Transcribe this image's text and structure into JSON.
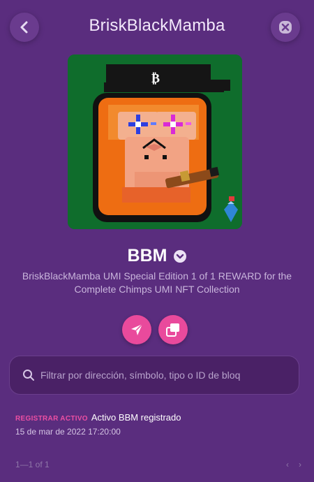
{
  "header": {
    "title": "BriskBlackMamba"
  },
  "asset": {
    "name": "BBM",
    "description": "BriskBlackMamba UMI Special Edition 1 of 1 REWARD for the Complete Chimps UMI NFT Collection",
    "image_icon": "pixel-chimp-nft",
    "badge_icon": "blue-gem-icon"
  },
  "actions": {
    "send_icon": "send-icon",
    "copy_icon": "copy-icon"
  },
  "search": {
    "placeholder": "Filtrar por dirección, símbolo, tipo o ID de bloq"
  },
  "activity": [
    {
      "type": "REGISTRAR ACTIVO",
      "text": "Activo BBM registrado",
      "date": "15 de mar de 2022 17:20:00"
    }
  ],
  "pagination": {
    "range": "1—1 of 1",
    "prev": "‹",
    "next": "›"
  },
  "colors": {
    "background": "#5a2d7e",
    "accent": "#e94a9c",
    "nft_bg": "#0f6d2c"
  }
}
